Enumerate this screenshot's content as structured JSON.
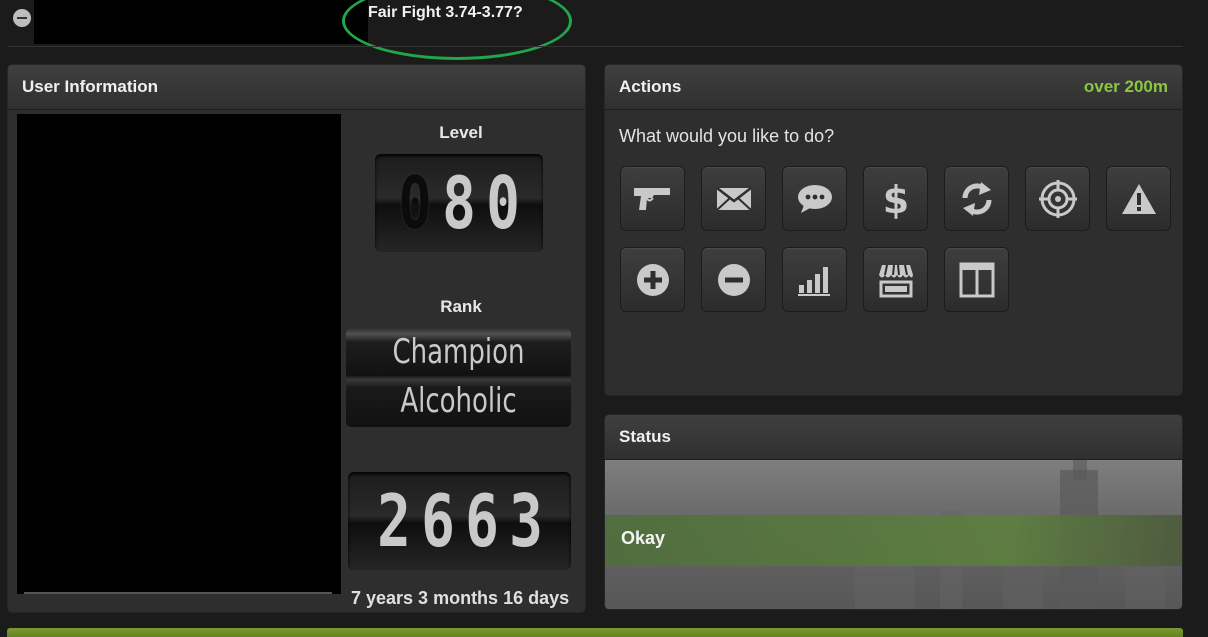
{
  "top": {
    "fair_fight": "Fair Fight 3.74-3.77?",
    "annotation_color": "#22a64a"
  },
  "user_info": {
    "title": "User Information",
    "level_label": "Level",
    "level_digits": [
      "0",
      "8",
      "0"
    ],
    "rank_label": "Rank",
    "rank_line1": "Champion",
    "rank_line2": "Alcoholic",
    "age_digits": [
      "2",
      "6",
      "6",
      "3"
    ],
    "duration": "7 years 3 months 16 days"
  },
  "actions": {
    "title": "Actions",
    "header_right": "over 200m",
    "header_right_color": "#8cc63f",
    "question": "What would you like to do?",
    "buttons": [
      {
        "icon": "gun-icon"
      },
      {
        "icon": "envelope-icon"
      },
      {
        "icon": "chat-bubble-icon"
      },
      {
        "icon": "dollar-icon"
      },
      {
        "icon": "trade-arrows-icon"
      },
      {
        "icon": "crosshair-icon"
      },
      {
        "icon": "warning-icon"
      },
      {
        "icon": "add-friend-icon"
      },
      {
        "icon": "add-enemy-icon"
      },
      {
        "icon": "stats-bars-icon"
      },
      {
        "icon": "shop-awning-icon"
      },
      {
        "icon": "bazaar-display-icon"
      }
    ]
  },
  "status": {
    "title": "Status",
    "text": "Okay"
  }
}
